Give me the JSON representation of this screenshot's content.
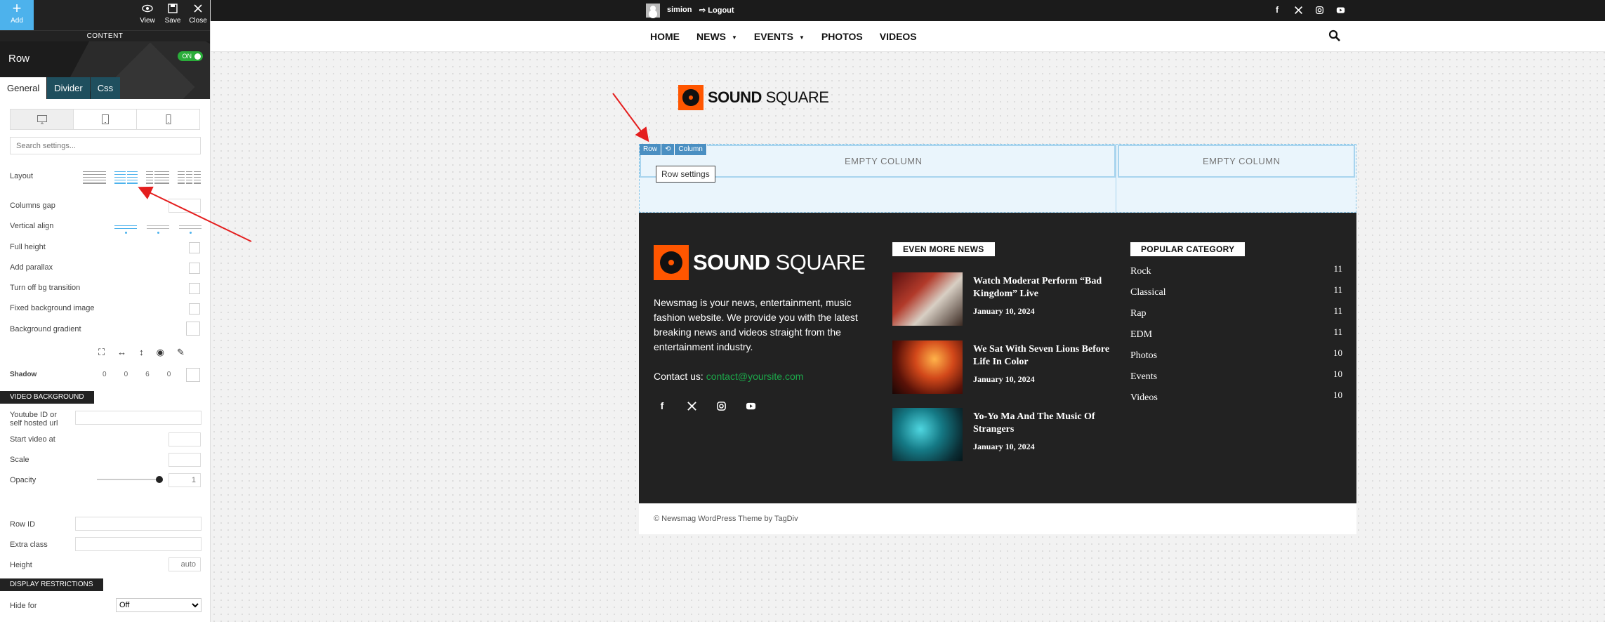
{
  "toolbar": {
    "add_label": "Add",
    "view_label": "View",
    "save_label": "Save",
    "close_label": "Close"
  },
  "content_label": "CONTENT",
  "row_panel": {
    "title": "Row",
    "toggle": "ON",
    "tabs": [
      {
        "label": "General"
      },
      {
        "label": "Divider"
      },
      {
        "label": "Css"
      }
    ]
  },
  "settings": {
    "search_placeholder": "Search settings...",
    "layout": "Layout",
    "columns_gap": "Columns gap",
    "vertical_align": "Vertical align",
    "full_height": "Full height",
    "add_parallax": "Add parallax",
    "turn_off_bg": "Turn off bg transition",
    "fixed_bg": "Fixed background image",
    "bg_gradient": "Background gradient",
    "shadow": "Shadow",
    "shadow_values": [
      "0",
      "0",
      "6",
      "0"
    ],
    "video_bg_header": "VIDEO BACKGROUND",
    "youtube_id": "Youtube ID or self hosted url",
    "start_video": "Start video at",
    "scale": "Scale",
    "opacity": "Opacity",
    "opacity_value": "1",
    "row_id": "Row ID",
    "extra_class": "Extra class",
    "height": "Height",
    "height_placeholder": "auto",
    "display_restrictions_header": "DISPLAY RESTRICTIONS",
    "hide_for": "Hide for",
    "hide_for_value": "Off"
  },
  "topbar": {
    "username": "simion",
    "logout": "Logout"
  },
  "nav": {
    "items": [
      {
        "label": "HOME"
      },
      {
        "label": "NEWS"
      },
      {
        "label": "EVENTS"
      },
      {
        "label": "PHOTOS"
      },
      {
        "label": "VIDEOS"
      }
    ]
  },
  "logo": {
    "text_bold": "SOUND",
    "text_rest": " SQUARE"
  },
  "builder": {
    "row_tool": "Row",
    "column_tool": "Column",
    "empty_column": "EMPTY COLUMN",
    "tooltip": "Row settings"
  },
  "footer": {
    "description": "Newsmag is your news, entertainment, music fashion website. We provide you with the latest breaking news and videos straight from the entertainment industry.",
    "contact_label": "Contact us:",
    "contact_email": "contact@yoursite.com",
    "news_header": "EVEN MORE NEWS",
    "news": [
      {
        "title": "Watch Moderat Perform “Bad Kingdom” Live",
        "date": "January 10, 2024"
      },
      {
        "title": "We Sat With Seven Lions Before Life In Color",
        "date": "January 10, 2024"
      },
      {
        "title": "Yo-Yo Ma And The Music Of Strangers",
        "date": "January 10, 2024"
      }
    ],
    "category_header": "POPULAR CATEGORY",
    "categories": [
      {
        "name": "Rock",
        "count": "11"
      },
      {
        "name": "Classical",
        "count": "11"
      },
      {
        "name": "Rap",
        "count": "11"
      },
      {
        "name": "EDM",
        "count": "11"
      },
      {
        "name": "Photos",
        "count": "10"
      },
      {
        "name": "Events",
        "count": "10"
      },
      {
        "name": "Videos",
        "count": "10"
      }
    ],
    "copyright": "© Newsmag WordPress Theme by TagDiv"
  },
  "colors": {
    "accent": "#4db2ec",
    "brand_orange": "#ff5600",
    "toggle_green": "#2aad3a",
    "link_green": "#1ca84a"
  }
}
